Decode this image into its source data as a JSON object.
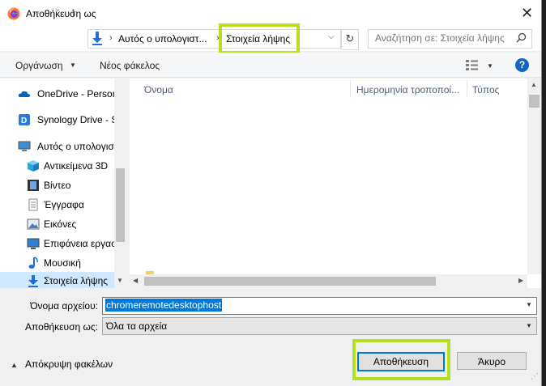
{
  "window": {
    "title": "Αποθήκευση ως",
    "close_glyph": "✕"
  },
  "nav": {
    "back_glyph": "←",
    "forward_glyph": "→",
    "recent_glyph": "⌄",
    "up_glyph": "↑",
    "breadcrumbs": [
      "Αυτός ο υπολογιστ...",
      "Στοιχεία λήψης"
    ],
    "crumb_separator": "›",
    "refresh_glyph": "↻",
    "search_placeholder": "Αναζήτηση σε: Στοιχεία λήψης"
  },
  "toolbar": {
    "organize_label": "Οργάνωση",
    "new_folder_label": "Νέος φάκελος",
    "help_label": "?"
  },
  "sidebar": {
    "items": [
      {
        "label": "OneDrive - Persor",
        "icon": "cloud-icon"
      },
      {
        "label": "Synology Drive - S",
        "icon": "synology-drive-icon"
      },
      {
        "label": "Αυτός ο υπολογισ",
        "icon": "computer-icon"
      },
      {
        "label": "Αντικείμενα 3D",
        "icon": "cube-3d-icon"
      },
      {
        "label": "Βίντεο",
        "icon": "film-icon"
      },
      {
        "label": "Έγγραφα",
        "icon": "document-icon"
      },
      {
        "label": "Εικόνες",
        "icon": "picture-icon"
      },
      {
        "label": "Επιφάνεια εργασ",
        "icon": "desktop-icon"
      },
      {
        "label": "Μουσική",
        "icon": "music-note-icon"
      },
      {
        "label": "Στοιχεία λήψης",
        "icon": "download-arrow-icon",
        "selected": true
      }
    ]
  },
  "filelist": {
    "columns": [
      "Όνομα",
      "Ημερομηνία τροποποί...",
      "Τύπος"
    ]
  },
  "form": {
    "filename_label": "Όνομα αρχείου:",
    "filename_value": "chromeremotedesktophost",
    "savetype_label": "Αποθήκευση ως:",
    "savetype_value": "Όλα τα αρχεία"
  },
  "footer": {
    "hide_folders_label": "Απόκρυψη φακέλων",
    "save_label": "Αποθήκευση",
    "cancel_label": "Άκυρο"
  },
  "colors": {
    "highlight": "#b4e01e",
    "selection": "#0078d7",
    "sidebar_selected": "#cde8ff"
  }
}
